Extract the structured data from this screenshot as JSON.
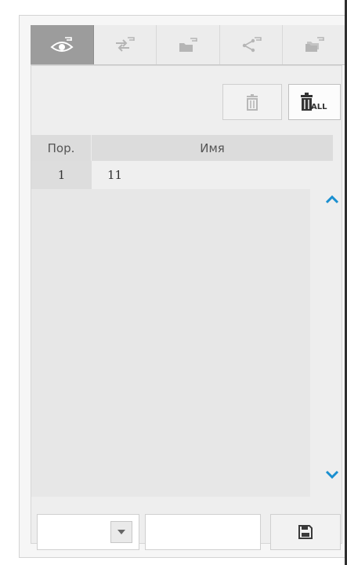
{
  "tabs": [
    {
      "name": "tab-view",
      "icon": "eye-icon",
      "active": true
    },
    {
      "name": "tab-swap",
      "icon": "swap-arrows-icon",
      "active": false
    },
    {
      "name": "tab-folder",
      "icon": "folder-icon",
      "active": false
    },
    {
      "name": "tab-share",
      "icon": "share-icon",
      "active": false
    },
    {
      "name": "tab-folders",
      "icon": "folders-icon",
      "active": false
    }
  ],
  "toolbar": {
    "delete_icon": "trash-icon",
    "delete_all_icon": "trash-all-icon",
    "delete_all_label": "ALL"
  },
  "table": {
    "headers": {
      "order": "Пор.",
      "name": "Имя"
    },
    "rows": [
      {
        "order": "1",
        "name": "11"
      }
    ]
  },
  "scroll": {
    "up_icon": "chevron-up-icon",
    "down_icon": "chevron-down-icon"
  },
  "bottom": {
    "select_value": "",
    "select_icon": "caret-down-icon",
    "input_value": "",
    "save_icon": "floppy-disk-icon"
  },
  "colors": {
    "accent": "#1a8fd0",
    "active_tab": "#9c9c9c"
  }
}
